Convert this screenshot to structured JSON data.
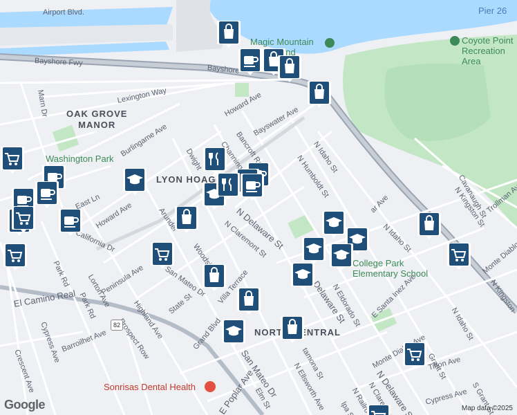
{
  "map": {
    "attribution": "Map data ©2025",
    "logo_text": "Google",
    "area_labels": [
      {
        "key": "oak",
        "lines": [
          "OAK GROVE",
          "MANOR"
        ]
      },
      {
        "key": "lyon",
        "lines": [
          "LYON HOAG"
        ]
      },
      {
        "key": "north",
        "lines": [
          "NORTH CENTRAL"
        ]
      }
    ],
    "poi_labels": {
      "magic": "Magic Mountain Playground",
      "coyote": "Coyote Point Recreation Area",
      "washington": "Washington Park",
      "college": "College Park Elementary School",
      "sonrisas": "Sonrisas Dental Health",
      "pier": "Pier 26"
    },
    "street_labels": {
      "airport": "Airport Blvd.",
      "bayshore1": "Bayshore Fwy",
      "bayshore2": "Bayshore",
      "lexington": "Lexington Way",
      "howard": "Howard Ave",
      "bayswater": "Bayswater Ave",
      "bancroft": "Bancroft Rd",
      "channing": "Channing",
      "dwight": "Dwight",
      "burlingame": "Burlingame Ave",
      "howard2": "Howard Ave",
      "eastln": "East Ln",
      "california": "California Dr",
      "parkrd": "Park Rd",
      "parkrd2": "Park Rd",
      "lorton": "Lorton Ave",
      "peninsula": "Peninsula Ave",
      "highland": "Highland Ave",
      "prospect": "Prospect Row",
      "state": "State St",
      "sanmateo": "San Mateo Dr",
      "woodside": "Woodside",
      "arundel": "Arundel",
      "ndelaware": "N Delaware St",
      "nclaremont": "N Claremont St",
      "villa": "Villa Terrace",
      "elcamino": "El Camino Real",
      "barroilhet": "Barroilhet Ave",
      "cypress": "Cypress Ave",
      "crescent": "Crescent Ave",
      "grand": "Grand Blvd",
      "sanmateo2": "San Mateo Dr",
      "epoplar": "E Poplar Ave",
      "elm": "Elm St",
      "nellsworth": "N Ellsworth Ave",
      "ramona": "Ramona St",
      "nidaho": "N Idaho St",
      "nhumboldt": "N Humboldt St",
      "nidaho2": "N Idaho St",
      "nkingston": "N Kingston St",
      "cavanaugh": "Cavanaugh St",
      "trollman": "Trollman Ave",
      "montediablo": "Monte Diablo Ave",
      "montediablo2": "Monte Diablo Ave",
      "esantainez": "E Santa Inez Ave",
      "neldorado": "N Eldorado St",
      "delaware2": "Delaware St",
      "ndelaware2": "N Delaware St",
      "nclaremont2": "N Claremont St",
      "nrailroad": "N Railro",
      "tilton": "Tilton Ave",
      "sgrant": "S Grant St",
      "cypress2": "Cypress Ave",
      "nidaho3": "N Idaho St",
      "nkingston2": "N Kingston",
      "marn": "Marn Dr",
      "r82": "82",
      "nlpa": "lpa St",
      "arrow": "ar Ave",
      "grantst": "Grant St",
      "nctramona": "tamona St"
    },
    "markers": [
      {
        "type": "shopping-bag"
      },
      {
        "type": "coffee"
      },
      {
        "type": "shopping-bag"
      },
      {
        "type": "shopping-bag"
      },
      {
        "type": "shopping-bag"
      },
      {
        "type": "restaurant"
      },
      {
        "type": "school"
      },
      {
        "type": "coffee"
      },
      {
        "type": "coffee"
      },
      {
        "type": "school"
      },
      {
        "type": "coffee"
      },
      {
        "type": "restaurant"
      },
      {
        "type": "shopping-bag"
      },
      {
        "type": "coffee"
      },
      {
        "type": "coffee"
      },
      {
        "type": "shopping-cart"
      },
      {
        "type": "shopping-cart"
      },
      {
        "type": "coffee"
      },
      {
        "type": "shopping-cart"
      },
      {
        "type": "shopping-cart"
      },
      {
        "type": "shopping-bag"
      },
      {
        "type": "shopping-bag"
      },
      {
        "type": "school"
      },
      {
        "type": "school"
      },
      {
        "type": "school"
      },
      {
        "type": "school"
      },
      {
        "type": "school"
      },
      {
        "type": "shopping-bag"
      },
      {
        "type": "shopping-cart"
      },
      {
        "type": "school"
      },
      {
        "type": "shopping-bag"
      },
      {
        "type": "shopping-cart"
      },
      {
        "type": "shopping-cart"
      },
      {
        "type": "shopping-cart"
      },
      {
        "type": "coffee"
      }
    ]
  }
}
